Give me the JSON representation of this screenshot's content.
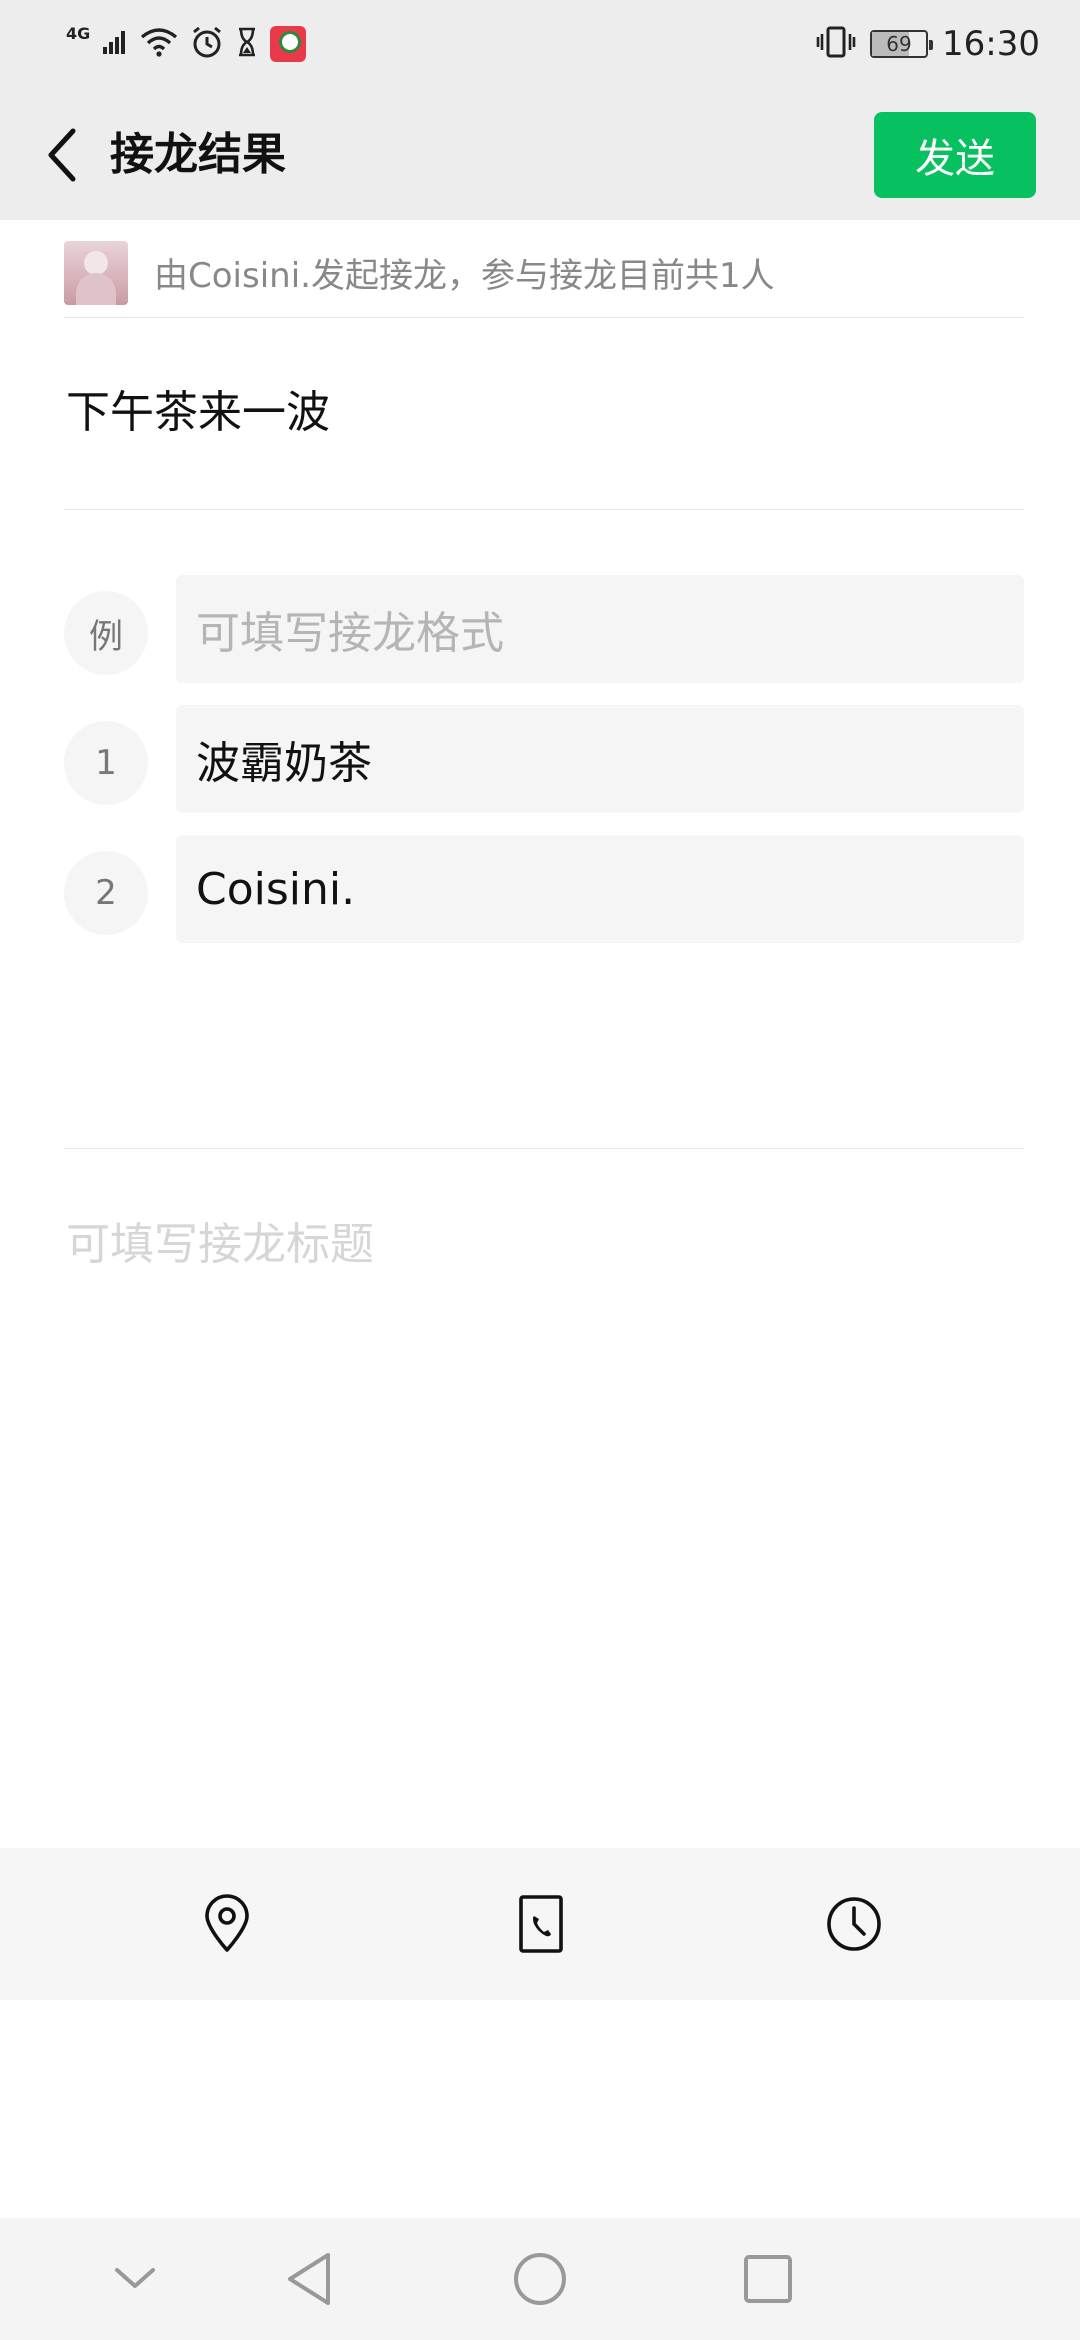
{
  "status_bar": {
    "network": "4G",
    "battery": "69",
    "time": "16:30",
    "icons": [
      "signal-icon",
      "wifi-icon",
      "alarm-icon",
      "hourglass-icon",
      "app-badge-icon",
      "vibrate-icon",
      "battery-icon"
    ]
  },
  "nav": {
    "title": "接龙结果",
    "send_label": "发送"
  },
  "initiator": {
    "text": "由Coisini.发起接龙，参与接龙目前共1人"
  },
  "topic": {
    "text": "下午茶来一波"
  },
  "entries": [
    {
      "number": "例",
      "text": "",
      "placeholder": "可填写接龙格式"
    },
    {
      "number": "1",
      "text": "波霸奶茶"
    },
    {
      "number": "2",
      "text": "Coisini."
    }
  ],
  "title_placeholder": "可填写接龙标题",
  "toolbar": {
    "icons": [
      "location-pin-icon",
      "phone-contact-icon",
      "clock-icon"
    ]
  },
  "system_nav": {
    "icons": [
      "chevron-down-icon",
      "back-triangle-icon",
      "home-circle-icon",
      "recents-square-icon"
    ]
  },
  "colors": {
    "accent": "#07c160",
    "header_bg": "#ededed",
    "entry_bg": "#f5f5f5"
  }
}
